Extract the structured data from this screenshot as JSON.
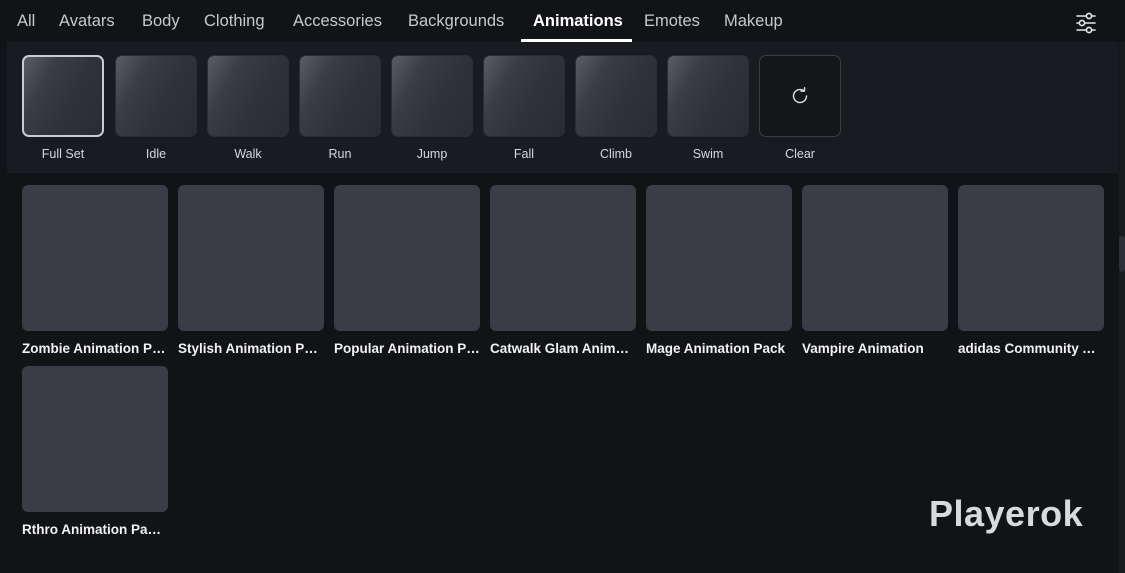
{
  "tabs": [
    {
      "label": "All"
    },
    {
      "label": "Avatars"
    },
    {
      "label": "Body"
    },
    {
      "label": "Clothing"
    },
    {
      "label": "Accessories"
    },
    {
      "label": "Backgrounds"
    },
    {
      "label": "Animations"
    },
    {
      "label": "Emotes"
    },
    {
      "label": "Makeup"
    }
  ],
  "active_tab": "Animations",
  "filter_icon": "sliders-icon",
  "slots": [
    {
      "label": "Full Set"
    },
    {
      "label": "Idle"
    },
    {
      "label": "Walk"
    },
    {
      "label": "Run"
    },
    {
      "label": "Jump"
    },
    {
      "label": "Fall"
    },
    {
      "label": "Climb"
    },
    {
      "label": "Swim"
    },
    {
      "label": "Clear"
    }
  ],
  "clear_icon": "refresh-icon",
  "items": [
    {
      "label": "Zombie Animation Pack"
    },
    {
      "label": "Stylish Animation Pack"
    },
    {
      "label": "Popular Animation Pack"
    },
    {
      "label": "Catwalk Glam Animation Pack"
    },
    {
      "label": "Mage Animation Pack"
    },
    {
      "label": "Vampire Animation"
    },
    {
      "label": "adidas Community Animation Pack"
    },
    {
      "label": "Rthro Animation Package"
    }
  ],
  "watermark": "Playerok",
  "colors": {
    "background": "#121317",
    "panel": "#191b20",
    "card": "#3a3c46",
    "active": "#ffffff"
  }
}
